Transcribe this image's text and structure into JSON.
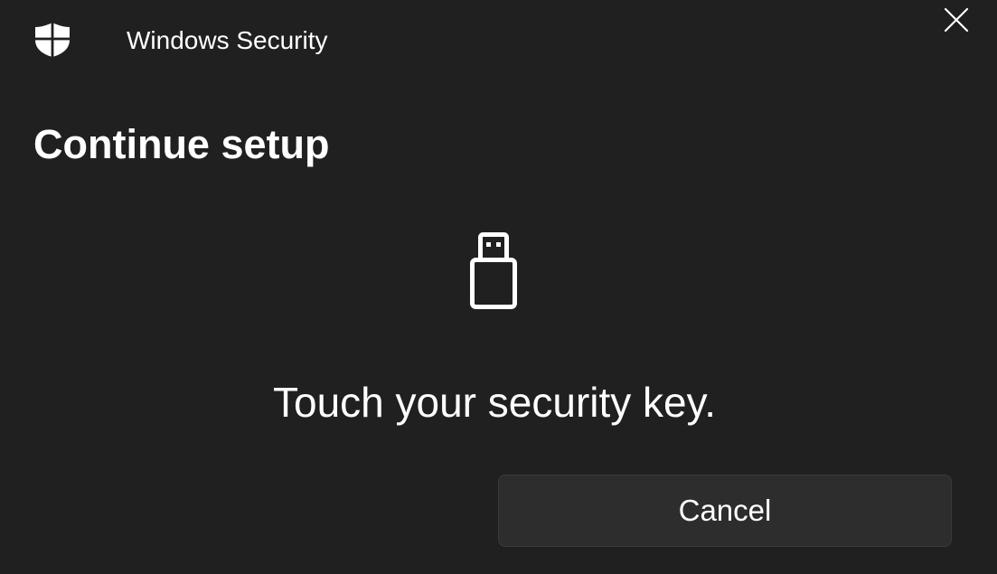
{
  "window": {
    "app_title": "Windows Security",
    "app_icon": "shield-icon",
    "close_icon": "close-icon"
  },
  "content": {
    "heading": "Continue setup",
    "illustration_icon": "usb-security-key-icon",
    "message": "Touch your security key."
  },
  "actions": {
    "cancel_label": "Cancel"
  },
  "colors": {
    "background": "#202020",
    "button_background": "#2d2d2d",
    "text": "#ffffff"
  }
}
